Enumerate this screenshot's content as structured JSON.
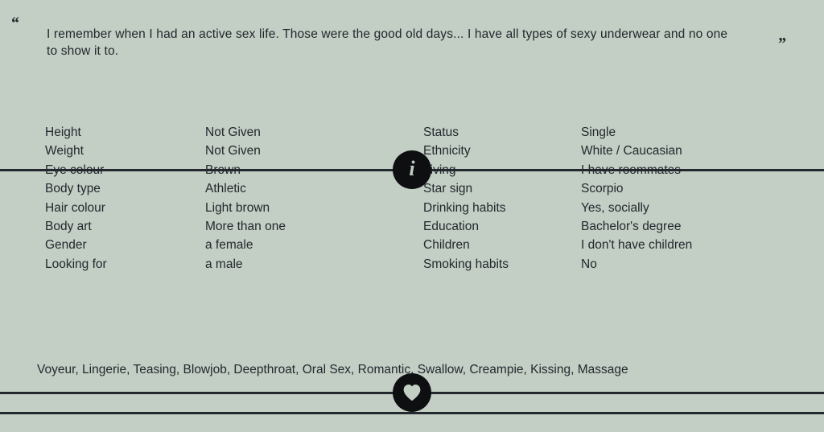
{
  "colors": {
    "background": "#c3cec4",
    "text": "#23282e",
    "rule": "#23282e",
    "medallion": "#0d0f11",
    "medallion_glyph": "#c3cec4"
  },
  "quote": {
    "open_mark": "“",
    "close_mark": "”",
    "text": "I remember when I had an active sex life. Those were the good old days... I have all types of sexy underwear and no one to show it to."
  },
  "dividers": {
    "info": {
      "icon": "info-circle-icon",
      "glyph": "i"
    },
    "heart": {
      "icon": "heart-circle-icon",
      "glyph": "♥"
    }
  },
  "details": {
    "left": [
      {
        "label": "Height",
        "value": "Not Given"
      },
      {
        "label": "Weight",
        "value": "Not Given"
      },
      {
        "label": "Eye colour",
        "value": "Brown"
      },
      {
        "label": "Body type",
        "value": "Athletic"
      },
      {
        "label": "Hair colour",
        "value": "Light brown"
      },
      {
        "label": "Body art",
        "value": "More than one"
      },
      {
        "label": "Gender",
        "value": "a female"
      },
      {
        "label": "Looking for",
        "value": "a male"
      }
    ],
    "right": [
      {
        "label": "Status",
        "value": "Single"
      },
      {
        "label": "Ethnicity",
        "value": "White / Caucasian"
      },
      {
        "label": "Living",
        "value": "I have roommates"
      },
      {
        "label": "Star sign",
        "value": "Scorpio"
      },
      {
        "label": "Drinking habits",
        "value": "Yes, socially"
      },
      {
        "label": "Education",
        "value": "Bachelor's degree"
      },
      {
        "label": "Children",
        "value": "I don't have children"
      },
      {
        "label": "Smoking habits",
        "value": "No"
      }
    ]
  },
  "interests": {
    "text": "Voyeur, Lingerie, Teasing, Blowjob, Deepthroat, Oral Sex, Romantic, Swallow, Creampie, Kissing, Massage",
    "items": [
      "Voyeur",
      "Lingerie",
      "Teasing",
      "Blowjob",
      "Deepthroat",
      "Oral Sex",
      "Romantic",
      "Swallow",
      "Creampie",
      "Kissing",
      "Massage"
    ]
  }
}
